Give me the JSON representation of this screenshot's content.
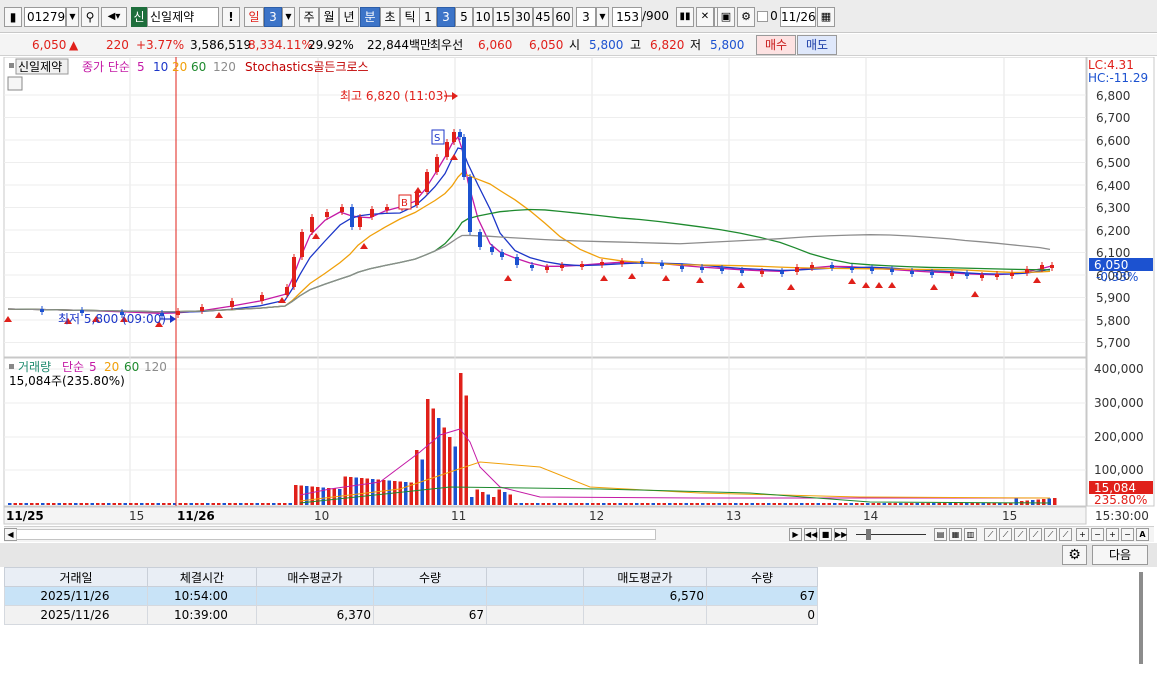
{
  "toolbar": {
    "code": "012790",
    "badge": "신",
    "stock_name": "신일제약",
    "alert": "!",
    "period_il": "일",
    "period_il_n": "3",
    "period_ju": "주",
    "period_wol": "월",
    "period_nyeon": "년",
    "period_bun": "분",
    "period_cho": "초",
    "period_tik": "틱",
    "minute_options": [
      "1",
      "3",
      "5",
      "10",
      "15",
      "30",
      "45",
      "60"
    ],
    "interval_value": "3",
    "count_value": "153",
    "count_total": "/900",
    "checkbox_label": "0",
    "date_value": "11/26"
  },
  "quote": {
    "price": "6,050",
    "change_arrow": "▲",
    "change": "220",
    "change_pct": "+3.77%",
    "volume": "3,586,519",
    "volume_pct": "8,334.11%",
    "turnover": "29.92%",
    "amount": "22,844백만",
    "best_ask_label": "최우선",
    "best_ask": "6,060",
    "best_bid": "6,050",
    "open_label": "시",
    "open": "5,800",
    "high_label": "고",
    "high": "6,820",
    "low_label": "저",
    "low": "5,800",
    "buy_label": "매수",
    "sell_label": "매도"
  },
  "chart": {
    "legend_stock": "신일제약",
    "legend_price_ma": "종가 단순",
    "ma_periods": [
      "5",
      "10",
      "20",
      "60",
      "120"
    ],
    "legend_stoch": "Stochastics골든크로스",
    "lc_label": "LC:4.31",
    "hc_label": "HC:-11.29",
    "high_annotation": "최고 6,820 (11:03)",
    "low_annotation": "최저 5,800 (09:00)",
    "price_axis": [
      "6,800",
      "6,700",
      "6,600",
      "6,500",
      "6,400",
      "6,300",
      "6,200",
      "6,100",
      "6,000",
      "5,900",
      "5,800",
      "5,700"
    ],
    "current_price_tag": "6,050",
    "current_pct_tag": "-0.33%",
    "volume_legend_name": "거래량",
    "volume_legend_ma": "단순",
    "volume_current": "15,084주(235.80%)",
    "volume_axis": [
      "400,000",
      "300,000",
      "200,000",
      "100,000"
    ],
    "volume_tag": "15,084",
    "volume_pct_tag": "235.80%",
    "time_labels": [
      "11/25",
      "15",
      "11/26",
      "10",
      "11",
      "12",
      "13",
      "14",
      "15"
    ],
    "time_end": "15:30:00",
    "ma_colors": {
      "ma5": "#c41aa6",
      "ma10": "#1c36c8",
      "ma20": "#f0a00a",
      "ma60": "#1e8a2e",
      "ma120": "#8c8c8c"
    },
    "up_color": "#e0201a",
    "down_color": "#1c52d0"
  },
  "nav": {
    "next_label": "다음"
  },
  "table": {
    "headers": [
      "거래일",
      "체결시간",
      "매수평균가",
      "수량",
      "",
      "매도평균가",
      "수량"
    ],
    "rows": [
      [
        "2025/11/26",
        "10:54:00",
        "",
        "",
        "",
        "6,570",
        "67"
      ],
      [
        "2025/11/26",
        "10:39:00",
        "6,370",
        "67",
        "",
        "",
        "0"
      ]
    ]
  }
}
